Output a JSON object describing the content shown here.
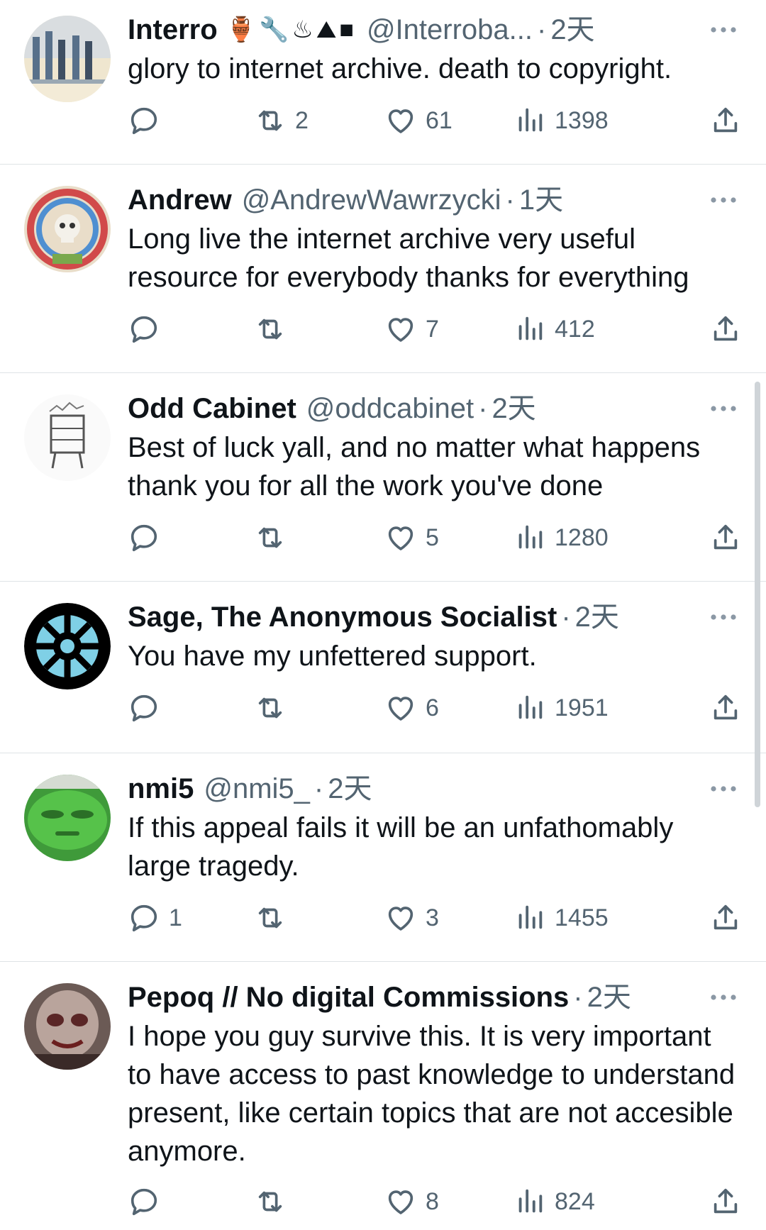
{
  "tweets": [
    {
      "name": "Interro",
      "emojis": "🏺🔧♨⛰■",
      "handle": "@Interroba...",
      "time": "2天",
      "text": "glory to internet archive. death to copyright.",
      "replies": "",
      "retweets": "2",
      "likes": "61",
      "views": "1398"
    },
    {
      "name": "Andrew",
      "emojis": "",
      "handle": "@AndrewWawrzycki",
      "time": "1天",
      "text": "Long live the internet archive very useful resource for everybody thanks for everything",
      "replies": "",
      "retweets": "",
      "likes": "7",
      "views": "412"
    },
    {
      "name": "Odd Cabinet",
      "emojis": "",
      "handle": "@oddcabinet",
      "time": "2天",
      "text": "Best of luck yall, and no matter what happens thank you for all the work you've done",
      "replies": "",
      "retweets": "",
      "likes": "5",
      "views": "1280"
    },
    {
      "name": "Sage, The Anonymous Socialist",
      "emojis": "",
      "handle": "",
      "time": "2天",
      "text": "You have my unfettered support.",
      "replies": "",
      "retweets": "",
      "likes": "6",
      "views": "1951"
    },
    {
      "name": "nmi5",
      "emojis": "",
      "handle": "@nmi5_",
      "time": "2天",
      "text": "If this appeal fails it will be an unfathomably large tragedy.",
      "replies": "1",
      "retweets": "",
      "likes": "3",
      "views": "1455"
    },
    {
      "name": "Pepoq // No digital Commissions",
      "emojis": "",
      "handle": "",
      "time": "2天",
      "text": "I hope you guy survive this. It is very important to have access to past knowledge to understand present, like certain topics that are not accesible anymore.",
      "replies": "",
      "retweets": "",
      "likes": "8",
      "views": "824"
    }
  ],
  "icons": {
    "reply": "reply-icon",
    "retweet": "retweet-icon",
    "like": "heart-icon",
    "views": "views-icon",
    "share": "share-icon",
    "more": "more-icon"
  },
  "colors": {
    "text": "#0f1419",
    "secondary": "#536471",
    "divider": "#dfe3e6"
  }
}
